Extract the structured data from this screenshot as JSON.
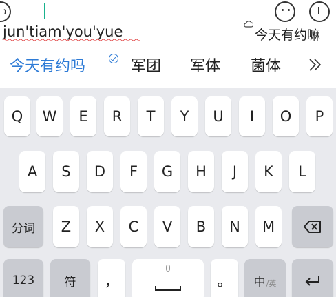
{
  "composition": {
    "pinyin": "jun'tiam'you'yue",
    "cloud_candidate": "今天有约嘛"
  },
  "candidates": [
    {
      "text": "今天有约吗",
      "highlighted": true
    },
    {
      "text": "军团",
      "highlighted": false
    },
    {
      "text": "军体",
      "highlighted": false
    },
    {
      "text": "菌体",
      "highlighted": false
    }
  ],
  "keyboard": {
    "row1": [
      "Q",
      "W",
      "E",
      "R",
      "T",
      "Y",
      "U",
      "I",
      "O",
      "P"
    ],
    "row2": [
      "A",
      "S",
      "D",
      "F",
      "G",
      "H",
      "J",
      "K",
      "L"
    ],
    "row3": [
      "Z",
      "X",
      "C",
      "V",
      "B",
      "N",
      "M"
    ],
    "fenci": "分词",
    "num": "123",
    "symbol": "符",
    "comma": "，",
    "period": "。",
    "lang_main": "中",
    "lang_sub": "/英"
  },
  "colors": {
    "accent": "#2e7bd6",
    "cursor": "#19b28d",
    "key_bg": "#ffffff",
    "key_dark_bg": "#c9cbd1",
    "keyboard_bg": "#e9eaee"
  },
  "icons": {
    "cloud": "cloud-icon",
    "check": "check-circle-icon",
    "expand": "double-chevron-right-icon",
    "backspace": "backspace-icon",
    "enter": "enter-icon",
    "mic": "mic-icon",
    "space": "space-bar-icon"
  }
}
